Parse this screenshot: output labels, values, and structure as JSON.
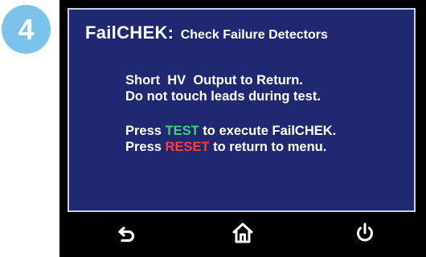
{
  "step": {
    "number": "4",
    "badge_color": "#7cc3ea"
  },
  "screen": {
    "title": "FailCHEK:",
    "subtitle": "Check Failure Detectors",
    "background_color": "#1f2870",
    "instructions": [
      "Short  HV  Output to Return.",
      "Do not touch leads during test."
    ],
    "actions": [
      {
        "prefix": "Press ",
        "keyword": "TEST",
        "keyword_color": "#3fd07a",
        "suffix": " to execute FailCHEK."
      },
      {
        "prefix": "Press ",
        "keyword": "RESET",
        "keyword_color": "#ff3b3b",
        "suffix": " to return to menu."
      }
    ]
  },
  "nav": {
    "back_icon": "back-arrow-icon",
    "home_icon": "home-icon",
    "power_icon": "power-icon"
  }
}
